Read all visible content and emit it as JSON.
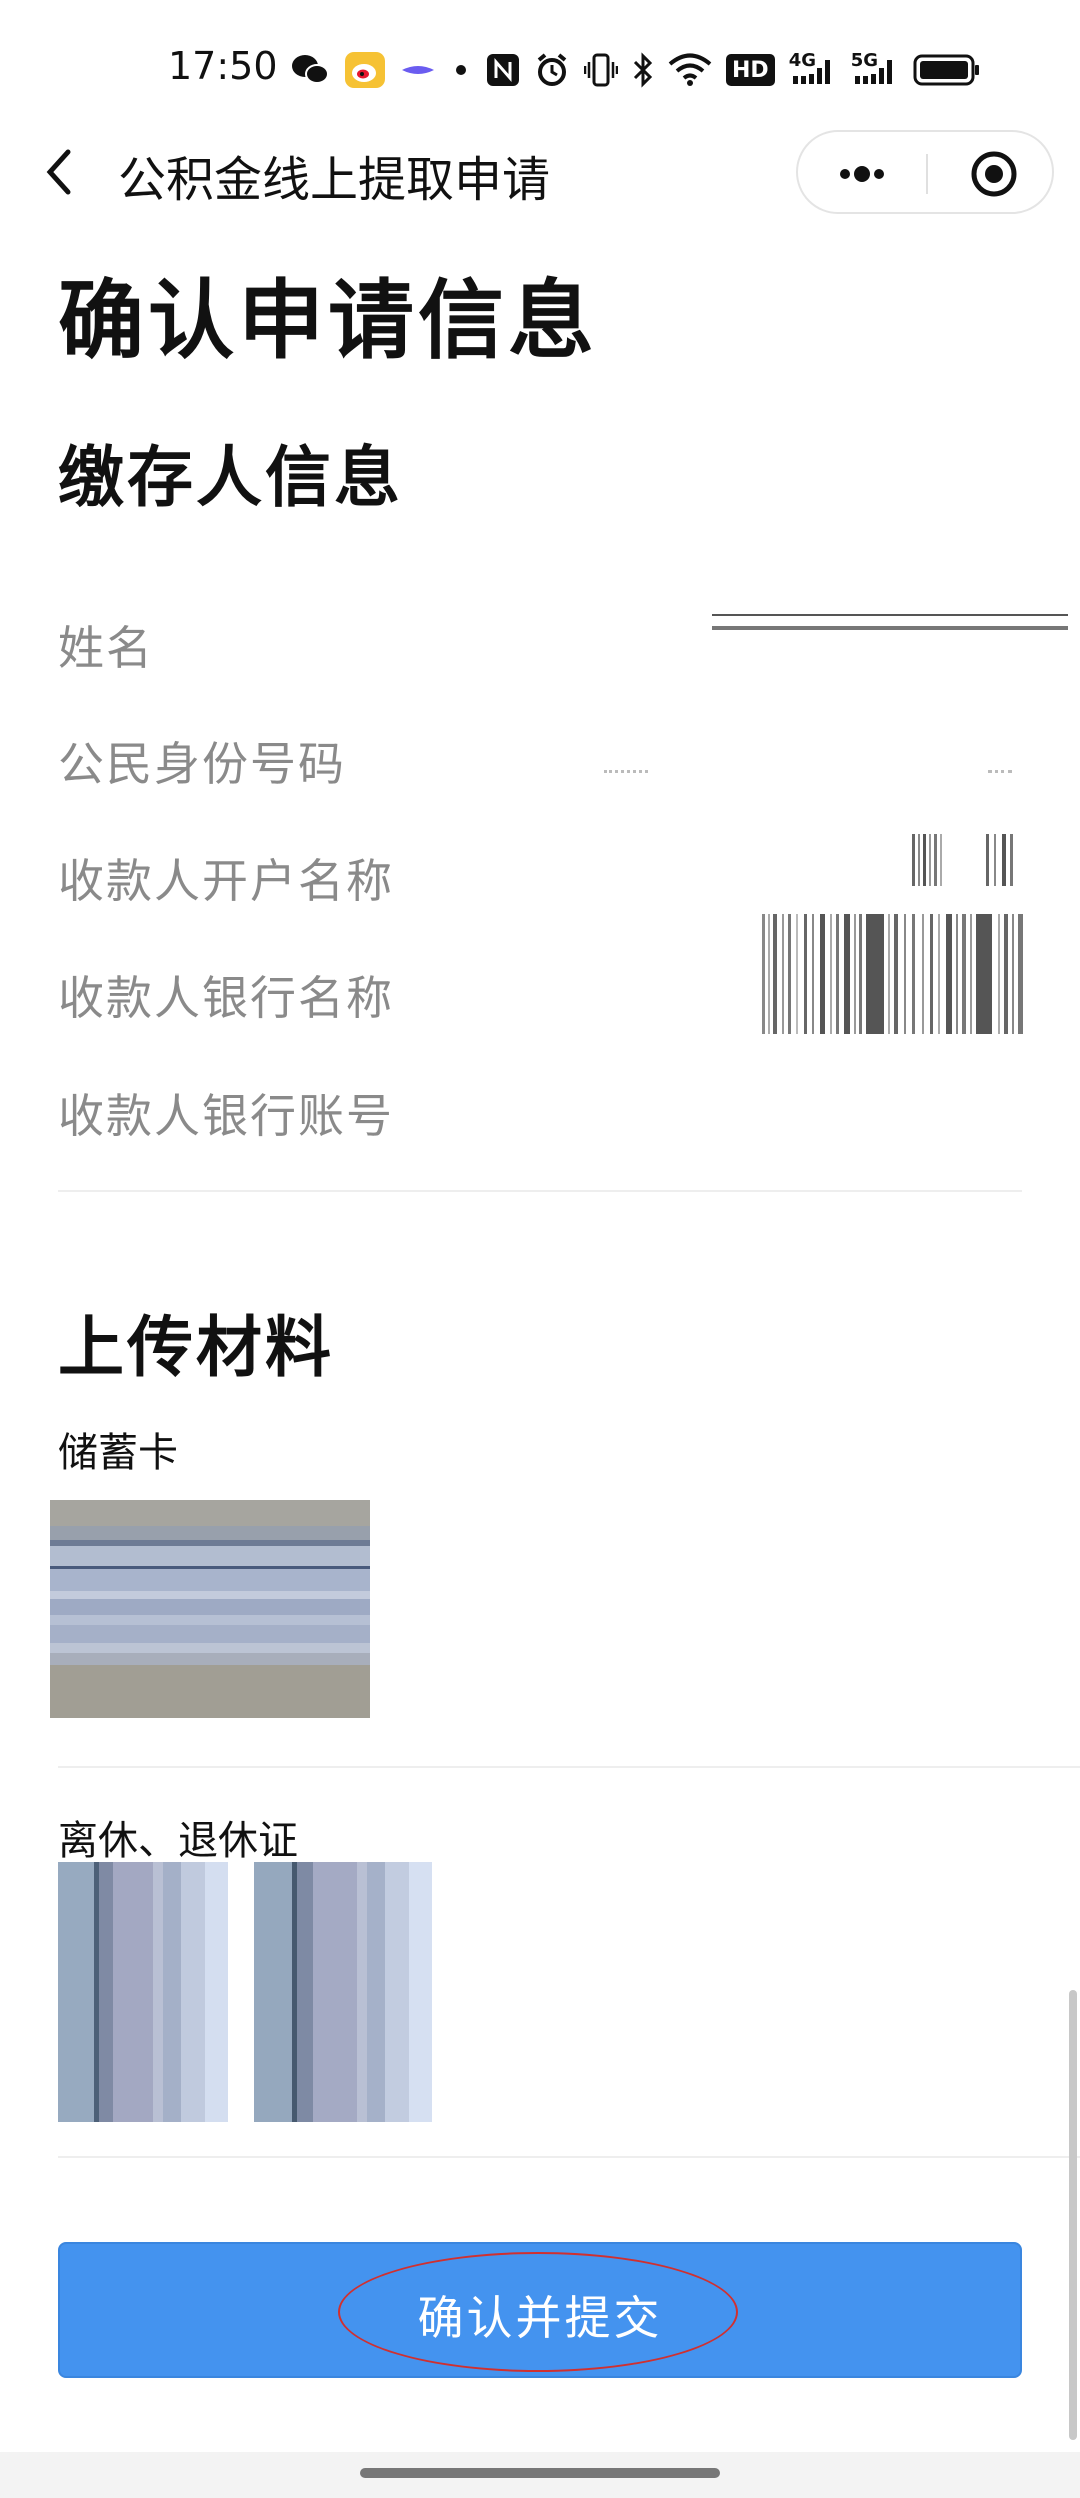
{
  "status_bar": {
    "time": "17:50",
    "icons": [
      "wechat-icon",
      "weibo-icon",
      "app-icon",
      "dot-icon",
      "nfc-icon",
      "alarm-icon",
      "vibrate-icon",
      "bluetooth-icon",
      "wifi-icon",
      "hd-icon",
      "signal-4g-icon",
      "signal-5g-icon",
      "battery-icon"
    ],
    "hd_label": "HD",
    "sig1_label": "4G",
    "sig2_label": "5G"
  },
  "nav": {
    "title": "公积金线上提取申请",
    "more_icon": "more-dots-icon",
    "close_icon": "capsule-record-icon"
  },
  "page_title": "确认申请信息",
  "depositor": {
    "section_title": "缴存人信息",
    "rows": [
      {
        "label": "姓名"
      },
      {
        "label": "公民身份号码"
      },
      {
        "label": "收款人开户名称"
      },
      {
        "label": "收款人银行名称"
      },
      {
        "label": "收款人银行账号"
      }
    ]
  },
  "uploads": {
    "section_title": "上传材料",
    "debit_card_label": "储蓄卡",
    "retire_cert_label": "离休、退休证"
  },
  "submit_label": "确认并提交",
  "colors": {
    "primary": "#4493ef",
    "label_gray": "#8a8a8a",
    "annotation_red": "#d03030"
  }
}
